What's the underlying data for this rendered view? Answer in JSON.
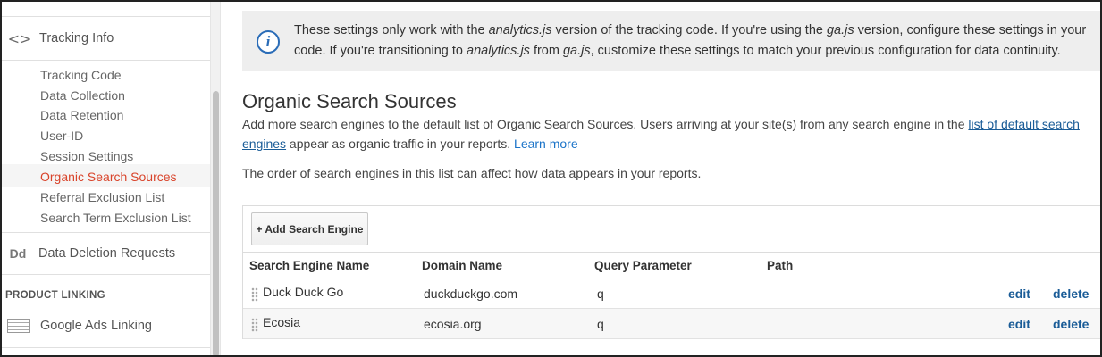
{
  "sidebar": {
    "header": {
      "icon": "code-brackets-icon",
      "label": "Tracking Info"
    },
    "subitems": [
      {
        "label": "Tracking Code"
      },
      {
        "label": "Data Collection"
      },
      {
        "label": "Data Retention"
      },
      {
        "label": "User-ID"
      },
      {
        "label": "Session Settings"
      },
      {
        "label": "Organic Search Sources",
        "active": true
      },
      {
        "label": "Referral Exclusion List"
      },
      {
        "label": "Search Term Exclusion List"
      }
    ],
    "data_deletion": {
      "icon_text": "Dd",
      "label": "Data Deletion Requests"
    },
    "section_label": "PRODUCT LINKING",
    "ads_linking": {
      "label": "Google Ads Linking"
    }
  },
  "info_box": {
    "line1_a": "These settings only work with the ",
    "line1_em1": "analytics.js",
    "line1_b": " version of the tracking code. If you're using the ",
    "line1_em2": "ga.js",
    "line1_c": " version, configure these settings in your",
    "line2_a": "code. If you're transitioning to ",
    "line2_em1": "analytics.js",
    "line2_b": " from ",
    "line2_em2": "ga.js",
    "line2_c": ", customize these settings to match your previous configuration for data continuity."
  },
  "main": {
    "title": "Organic Search Sources",
    "desc_a": "Add more search engines to the default list of Organic Search Sources. Users arriving at your site(s) from any search engine in the ",
    "desc_link": "list of default search engines",
    "desc_b": " appear as organic traffic in your reports. ",
    "learn_more": "Learn more",
    "order_note": "The order of search engines in this list can affect how data appears in your reports.",
    "add_button": "+ Add Search Engine"
  },
  "table": {
    "headers": {
      "name": "Search Engine Name",
      "domain": "Domain Name",
      "query": "Query Parameter",
      "path": "Path"
    },
    "rows": [
      {
        "name": "Duck Duck Go",
        "domain": "duckduckgo.com",
        "query": "q",
        "path": "",
        "edit": "edit",
        "delete": "delete"
      },
      {
        "name": "Ecosia",
        "domain": "ecosia.org",
        "query": "q",
        "path": "",
        "edit": "edit",
        "delete": "delete"
      }
    ]
  },
  "colors": {
    "active_nav": "#d9442b",
    "link": "#1a5c97",
    "info_icon": "#2a6cb7"
  }
}
